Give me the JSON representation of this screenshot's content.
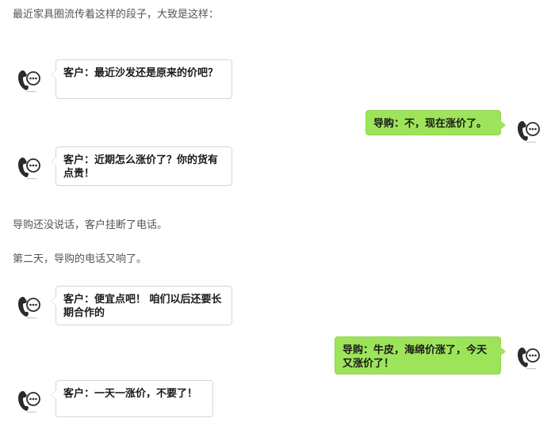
{
  "intro": "最近家具圈流传着这样的段子，大致是这样：",
  "conversation1": [
    {
      "side": "left",
      "text": "客户：最近沙发还是原来的价吧？"
    },
    {
      "side": "right",
      "text": "导购：不，现在涨价了。"
    },
    {
      "side": "left",
      "text": "客户：近期怎么涨价了？你的货有点贵！"
    }
  ],
  "narration1": "导购还没说话，客户挂断了电话。",
  "narration2": "第二天，导购的电话又响了。",
  "conversation2": [
    {
      "side": "left",
      "text": "客户：便宜点吧！ 咱们以后还要长期合作的"
    },
    {
      "side": "right",
      "text": "导购：牛皮，海绵价涨了，今天又涨价了！"
    },
    {
      "side": "left",
      "text": "客户：一天一涨价，不要了！"
    }
  ],
  "icons": {
    "avatar": "phone-chat-icon"
  },
  "colors": {
    "right_bubble": "#9de45a",
    "left_bubble_border": "#d6d6d6"
  }
}
